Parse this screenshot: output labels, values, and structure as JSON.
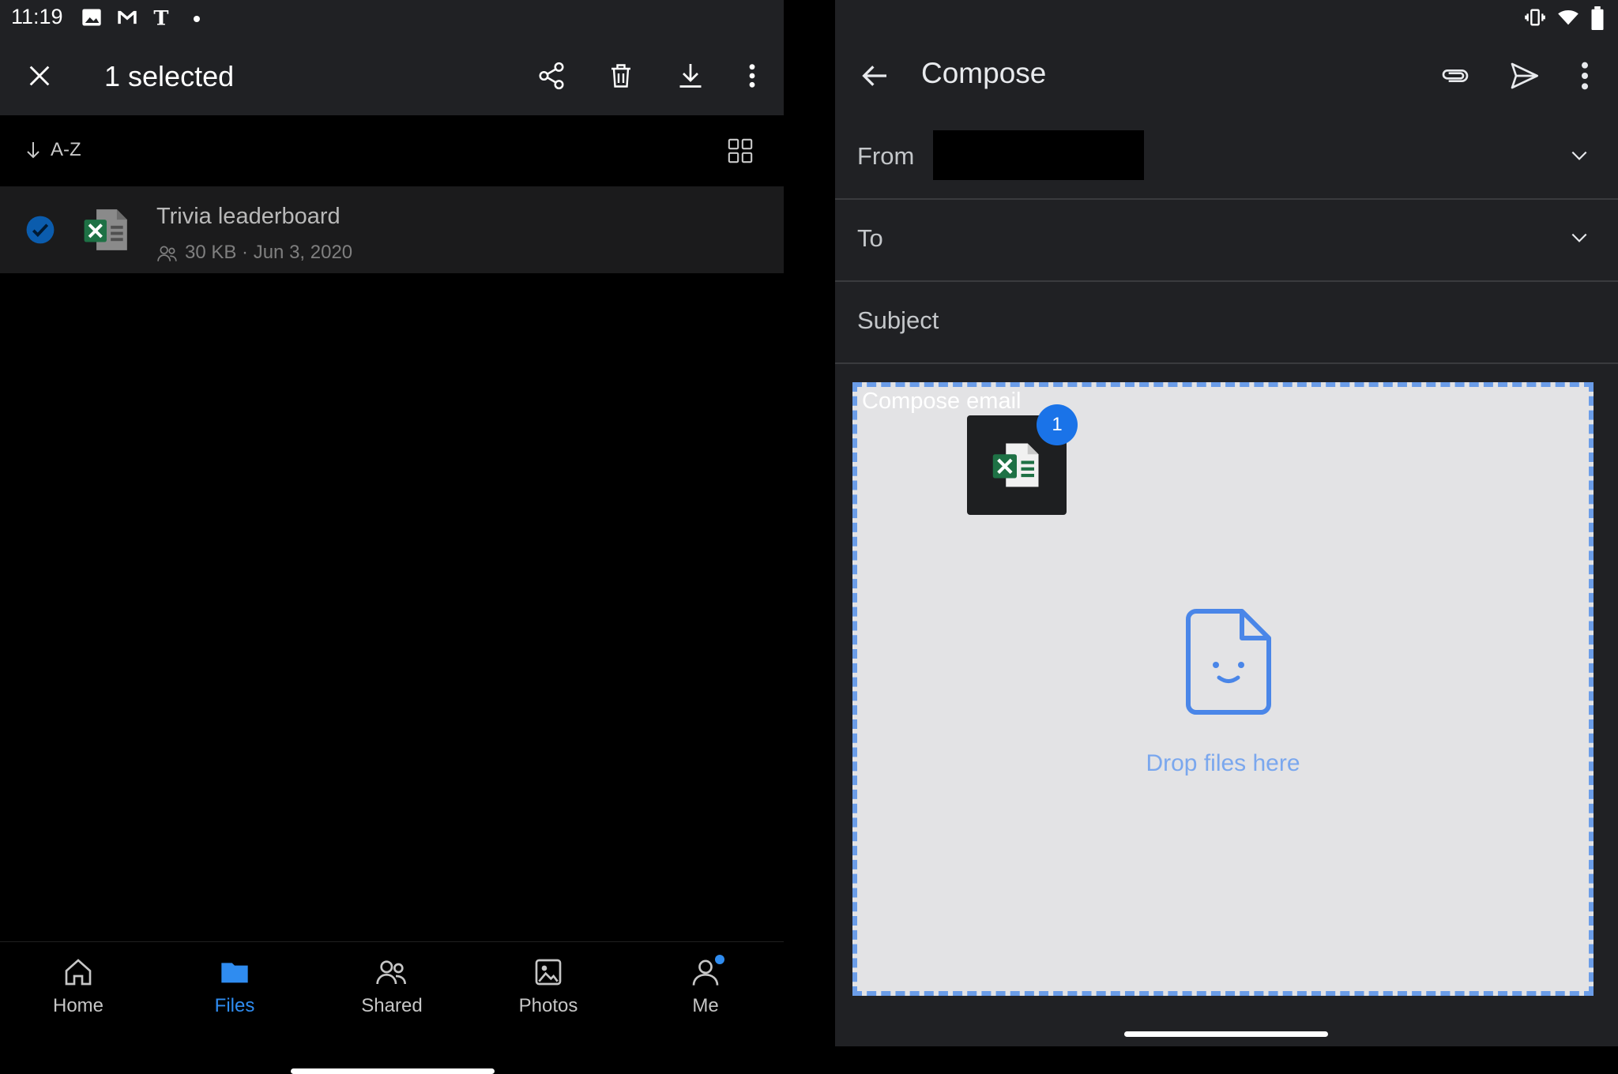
{
  "status_bar": {
    "time": "11:19",
    "notification_icons": [
      "image-icon",
      "gmail-icon",
      "nyt-icon",
      "dot-icon"
    ],
    "system_icons": [
      "vibrate-icon",
      "wifi-icon",
      "battery-icon"
    ]
  },
  "onedrive": {
    "appbar": {
      "title": "1 selected",
      "actions": [
        "share-icon",
        "delete-icon",
        "download-icon",
        "more-icon"
      ]
    },
    "sort": {
      "label": "A-Z"
    },
    "files": [
      {
        "name": "Trivia leaderboard",
        "meta": "30 KB · Jun 3, 2020",
        "type": "excel",
        "shared": true,
        "selected": true
      }
    ],
    "bottom_nav": {
      "active": "Files",
      "items": [
        {
          "label": "Home",
          "icon": "home-icon"
        },
        {
          "label": "Files",
          "icon": "folder-icon"
        },
        {
          "label": "Shared",
          "icon": "people-icon"
        },
        {
          "label": "Photos",
          "icon": "photo-icon"
        },
        {
          "label": "Me",
          "icon": "person-icon"
        }
      ]
    }
  },
  "compose": {
    "title": "Compose",
    "from_label": "From",
    "to_label": "To",
    "subject_label": "Subject",
    "body_placeholder": "Compose email",
    "drop_text": "Drop files here",
    "drag_count": "1"
  },
  "colors": {
    "accent": "#1a73e8",
    "files_active": "#2f8cf0",
    "drop_border": "#6b9de8",
    "excel_green": "#1e7145"
  }
}
